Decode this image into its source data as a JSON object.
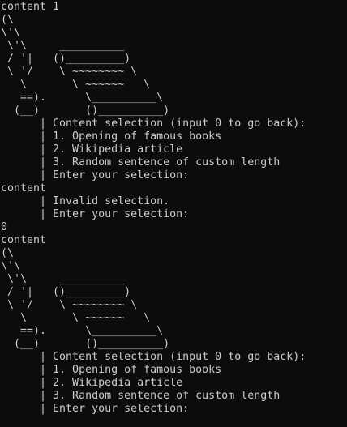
{
  "terminal": {
    "lines": [
      "content 1",
      "(\\",
      "\\'\\",
      " \\'\\     __________",
      " / '|   ()_________)",
      " \\ '/    \\ ~~~~~~~~ \\",
      "   \\       \\ ~~~~~~   \\",
      "   ==).      \\__________\\",
      "  (__)       ()__________)",
      "      | Content selection (input 0 to go back):",
      "      | 1. Opening of famous books",
      "      | 2. Wikipedia article",
      "      | 3. Random sentence of custom length",
      "      | Enter your selection:",
      "content",
      "      | Invalid selection.",
      "      | Enter your selection:",
      "0",
      "content",
      "(\\",
      "\\'\\",
      " \\'\\     __________",
      " / '|   ()_________)",
      " \\ '/    \\ ~~~~~~~~ \\",
      "   \\       \\ ~~~~~~   \\",
      "   ==).      \\__________\\",
      "  (__)       ()__________)",
      "      | Content selection (input 0 to go back):",
      "      | 1. Opening of famous books",
      "      | 2. Wikipedia article",
      "      | 3. Random sentence of custom length",
      "      | Enter your selection:"
    ]
  }
}
